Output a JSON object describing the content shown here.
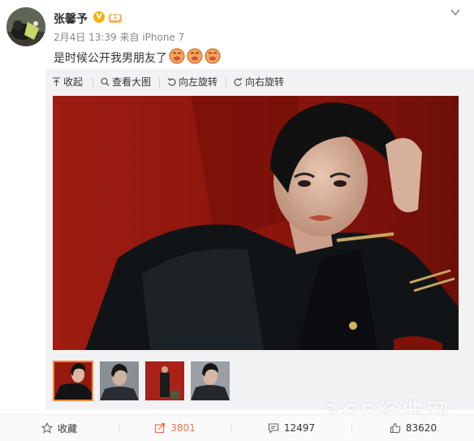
{
  "post": {
    "author": "张馨予",
    "time": "2月4日 13:39",
    "source_prefix": "来自",
    "source": "iPhone 7",
    "text": "是时候公开我男朋友了"
  },
  "toolbar": {
    "collapse": "收起",
    "view_large": "查看大图",
    "rotate_left": "向左旋转",
    "rotate_right": "向右旋转"
  },
  "gallery": {
    "thumbnail_count": 4,
    "selected_index": 0
  },
  "watermark": "365经典网",
  "actions": {
    "favorite": "收藏",
    "repost": "3801",
    "comment": "12497",
    "like": "83620"
  },
  "colors": {
    "accent": "#eb7350",
    "thumb_border": "#f08a3c",
    "photo_red": "#9a1a10"
  },
  "icons": {
    "verified": "verified-v-icon",
    "member": "member-crown-icon",
    "dropdown": "chevron-down-icon",
    "collapse": "collapse-up-icon",
    "search": "magnify-icon",
    "rotate_left": "rotate-left-icon",
    "rotate_right": "rotate-right-icon",
    "favorite": "star-icon",
    "repost": "repost-icon",
    "comment": "comment-icon",
    "like": "thumbs-up-icon"
  }
}
